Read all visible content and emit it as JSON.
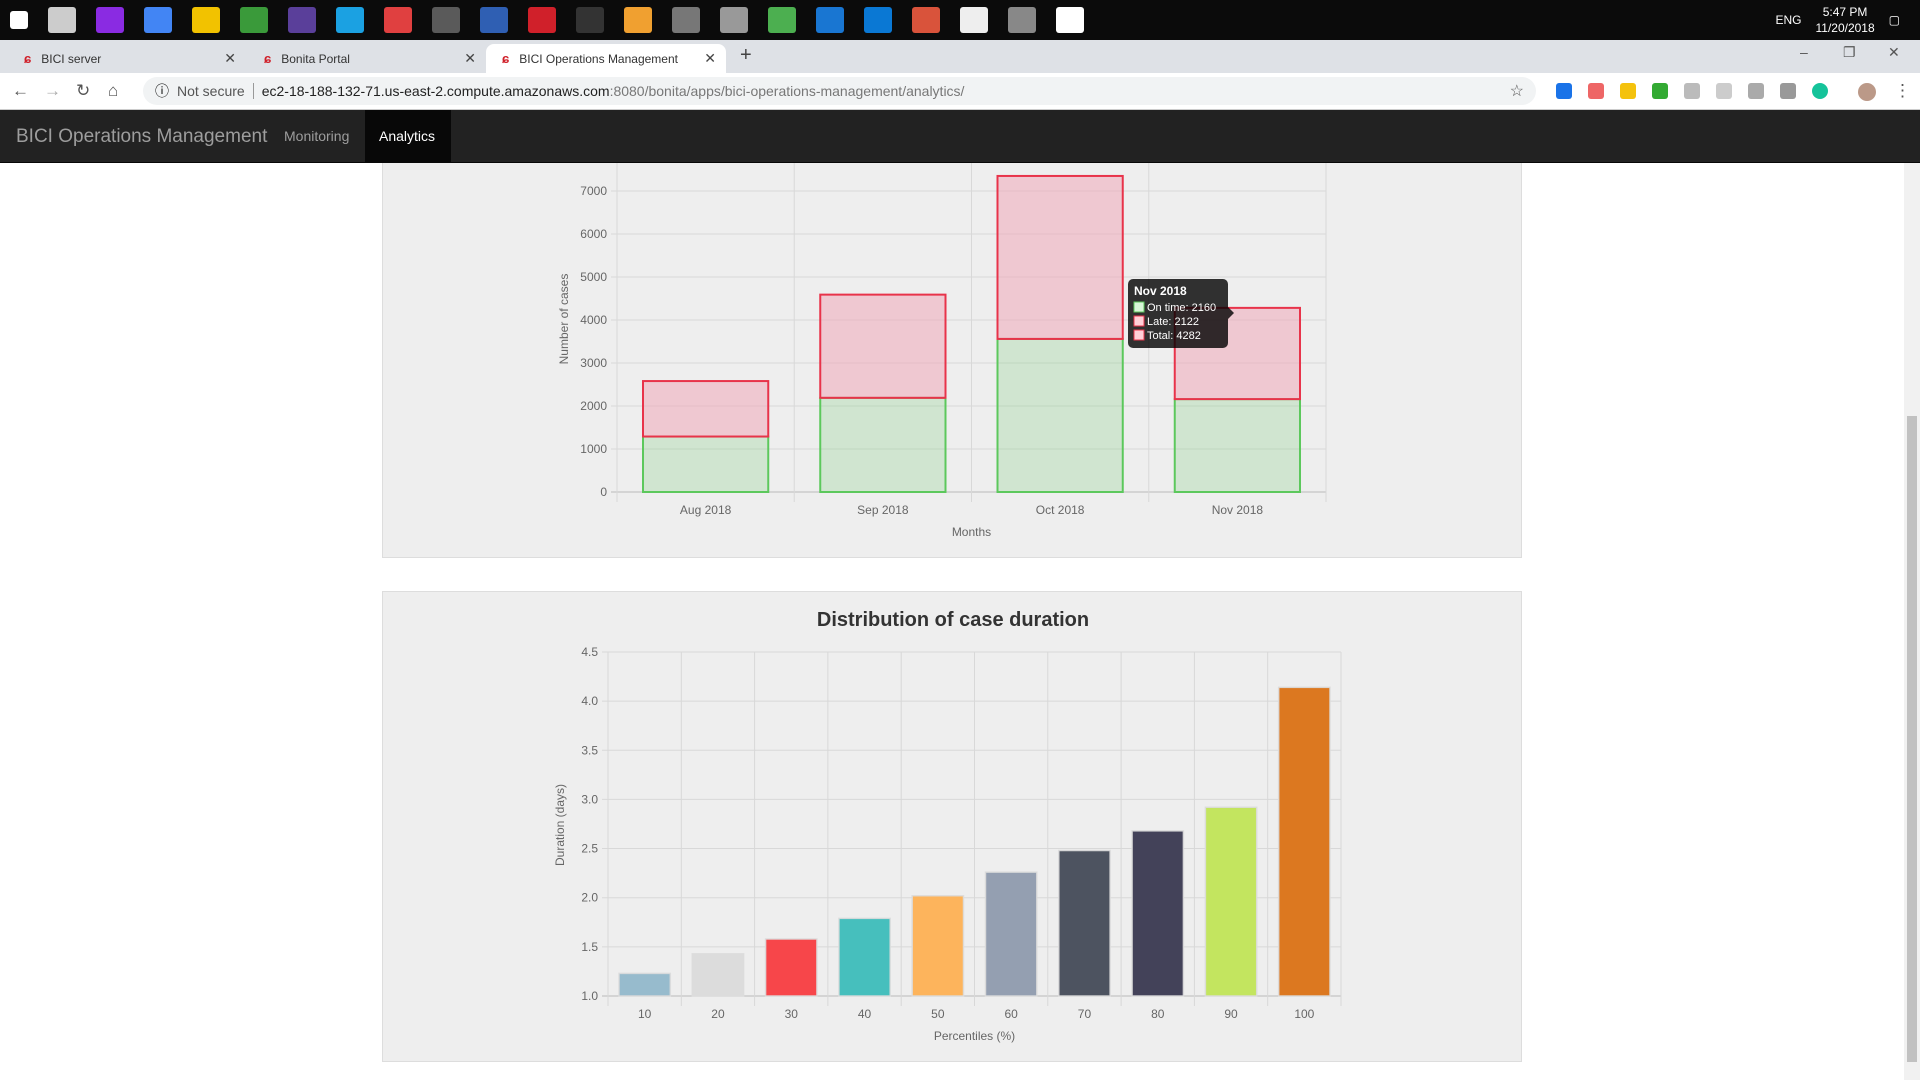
{
  "taskbar": {
    "time": "5:47 PM",
    "date": "11/20/2018",
    "lang": "ENG",
    "icon_colors": [
      "#ffffff",
      "#cccccc",
      "#8a2be2",
      "#4285f4",
      "#f2c200",
      "#3a9a3a",
      "#5a3f9a",
      "#1ba1e2",
      "#e04040",
      "#5a5a5a",
      "#2f5fb3",
      "#d0202a",
      "#333333",
      "#f0a030",
      "#777777",
      "#999999",
      "#4caf50",
      "#1976d2",
      "#0a78d4",
      "#d9533b",
      "#eeeeee",
      "#888888",
      "#ffffff"
    ]
  },
  "browser": {
    "tabs": [
      {
        "label": "BICI server"
      },
      {
        "label": "Bonita Portal"
      },
      {
        "label": "BICI Operations Management"
      }
    ],
    "not_secure": "Not secure",
    "url_host": "ec2-18-188-132-71.us-east-2.compute.amazonaws.com",
    "url_path": ":8080/bonita/apps/bici-operations-management/analytics/"
  },
  "navbar": {
    "brand": "BICI Operations Management",
    "links": [
      {
        "label": "Monitoring",
        "active": false
      },
      {
        "label": "Analytics",
        "active": true
      }
    ]
  },
  "chart_data": [
    {
      "type": "bar",
      "stacked": true,
      "categories": [
        "Aug 2018",
        "Sep 2018",
        "Oct 2018",
        "Nov 2018"
      ],
      "series": [
        {
          "name": "On time",
          "values": [
            1290,
            2190,
            3560,
            2160
          ],
          "color": "#5cc85c"
        },
        {
          "name": "Late",
          "values": [
            1290,
            2400,
            3790,
            2122
          ],
          "color": "#e8334a"
        }
      ],
      "xlabel": "Months",
      "ylabel": "Number of cases",
      "yticks": [
        0,
        1000,
        2000,
        3000,
        4000,
        5000,
        6000,
        7000
      ],
      "grid": true,
      "tooltip": {
        "title": "Nov 2018",
        "lines": [
          "On time: 2160",
          "Late: 2122",
          "Total: 4282"
        ]
      }
    },
    {
      "type": "bar",
      "title": "Distribution of case duration",
      "categories": [
        "10",
        "20",
        "30",
        "40",
        "50",
        "60",
        "70",
        "80",
        "90",
        "100"
      ],
      "values": [
        1.23,
        1.43,
        1.58,
        1.79,
        2.02,
        2.26,
        2.48,
        2.68,
        2.92,
        4.14
      ],
      "colors": [
        "#97bbcd",
        "#dcdcdc",
        "#f7464a",
        "#46bfbd",
        "#fdb45c",
        "#949fb1",
        "#4d5360",
        "#434259",
        "#c3e55f",
        "#dc7820"
      ],
      "xlabel": "Percentiles (%)",
      "ylabel": "Duration (days)",
      "ylim": [
        1.0,
        4.5
      ],
      "yticks": [
        "1.0",
        "1.5",
        "2.0",
        "2.5",
        "3.0",
        "3.5",
        "4.0",
        "4.5"
      ],
      "grid": true
    }
  ]
}
